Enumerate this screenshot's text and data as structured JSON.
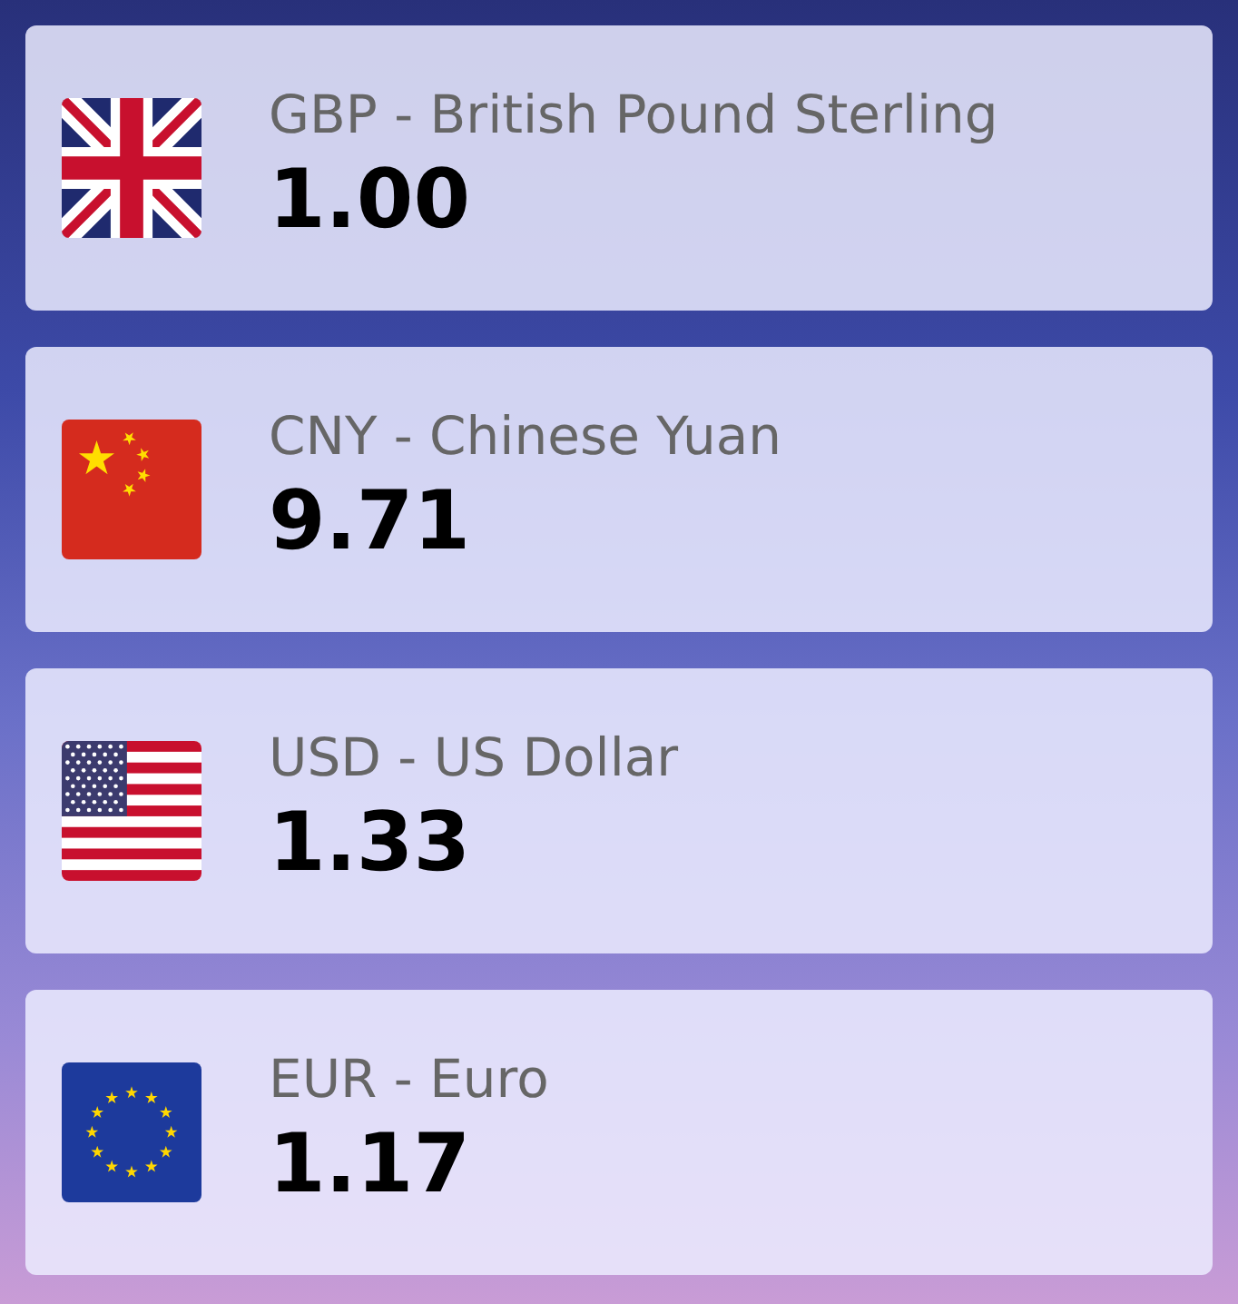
{
  "currencies": [
    {
      "kind": "gb",
      "label": "GBP - British Pound Sterling",
      "value": "1.00"
    },
    {
      "kind": "cn",
      "label": "CNY - Chinese Yuan",
      "value": "9.71"
    },
    {
      "kind": "us",
      "label": "USD - US Dollar",
      "value": "1.33"
    },
    {
      "kind": "eu",
      "label": "EUR - Euro",
      "value": "1.17"
    }
  ]
}
